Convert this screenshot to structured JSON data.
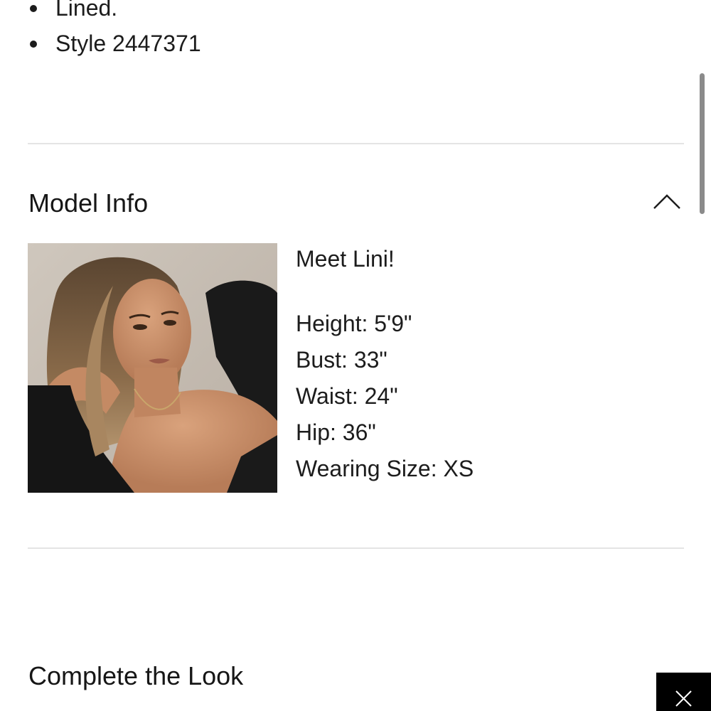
{
  "details": {
    "bullets": [
      "Lined.",
      "Style 2447371"
    ]
  },
  "model_info": {
    "title": "Model Info",
    "toggle_icon": "chevron-up-icon",
    "photo_alt": "Model photo",
    "intro": "Meet Lini!",
    "stats": [
      "Height: 5'9\"",
      "Bust: 33\"",
      "Waist: 24\"",
      "Hip: 36\"",
      "Wearing Size: XS"
    ]
  },
  "complete_the_look": {
    "title": "Complete the Look"
  },
  "overlay": {
    "close_icon": "close-icon",
    "close_bg": "#000000"
  }
}
